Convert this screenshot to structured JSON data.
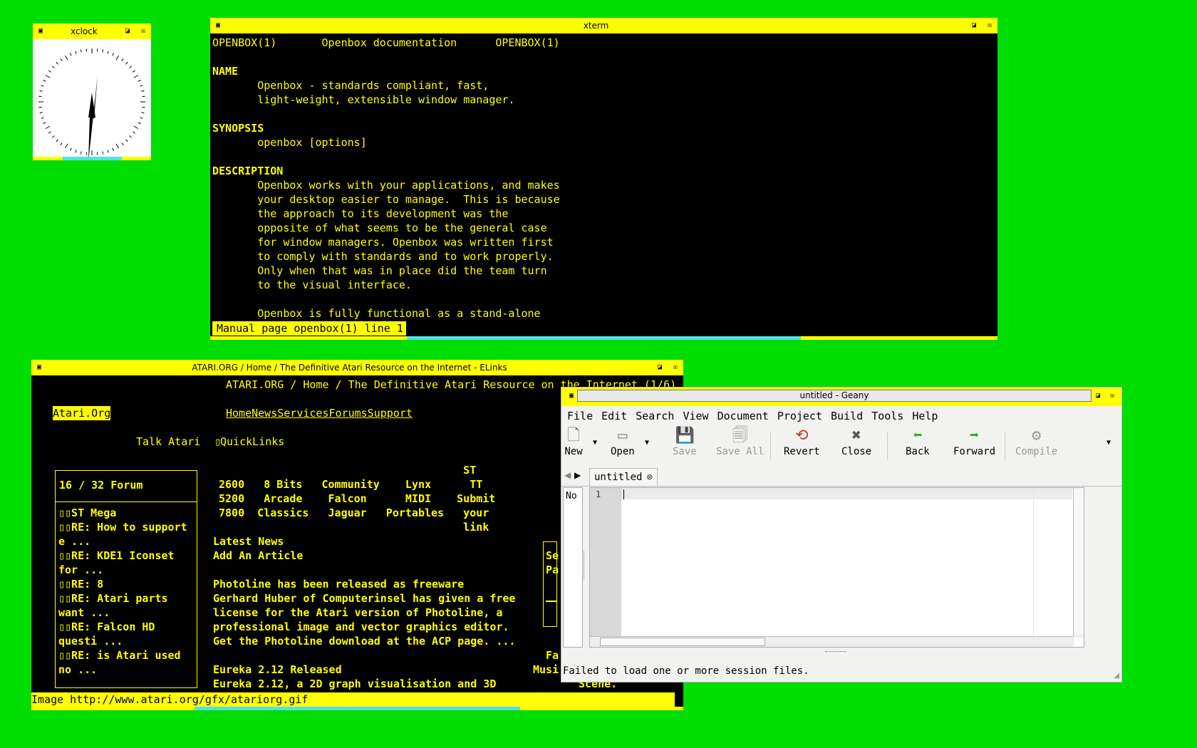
{
  "xclock": {
    "title": "xclock",
    "icons": {
      "menu": "window-menu-icon",
      "maximize": "maximize-icon",
      "close": "close-icon"
    }
  },
  "xterm": {
    "title": "xterm",
    "lines": [
      {
        "text": "OPENBOX(1)       Openbox documentation      OPENBOX(1)",
        "bold": false
      },
      {
        "text": "",
        "bold": false
      },
      {
        "text": "NAME",
        "bold": true
      },
      {
        "text": "       Openbox - standards compliant, fast,",
        "bold": false
      },
      {
        "text": "       light-weight, extensible window manager.",
        "bold": false
      },
      {
        "text": "",
        "bold": false
      },
      {
        "text": "SYNOPSIS",
        "bold": true
      },
      {
        "text": "       openbox [options]",
        "bold": false
      },
      {
        "text": "",
        "bold": false
      },
      {
        "text": "DESCRIPTION",
        "bold": true
      },
      {
        "text": "       Openbox works with your applications, and makes",
        "bold": false
      },
      {
        "text": "       your desktop easier to manage.  This is because",
        "bold": false
      },
      {
        "text": "       the approach to its development was the",
        "bold": false
      },
      {
        "text": "       opposite of what seems to be the general case",
        "bold": false
      },
      {
        "text": "       for window managers. Openbox was written first",
        "bold": false
      },
      {
        "text": "       to comply with standards and to work properly.",
        "bold": false
      },
      {
        "text": "       Only when that was in place did the team turn",
        "bold": false
      },
      {
        "text": "       to the visual interface.",
        "bold": false
      },
      {
        "text": "",
        "bold": false
      },
      {
        "text": "       Openbox is fully functional as a stand-alone",
        "bold": false
      }
    ],
    "status": "Manual page openbox(1) line 1"
  },
  "elinks": {
    "title": "ATARI.ORG / Home / The Definitive Atari Resource on the Internet - ELinks",
    "page_title": "ATARI.ORG / Home / The Definitive Atari Resource on the Internet (1/6)",
    "site_link": "Atari.Org",
    "nav": "HomeNewsServicesForumsSupport",
    "talk": "Talk Atari",
    "quicklinks": "QuickLinks",
    "forum_header": "16 / 32 Forum",
    "forum_lines": [
      "▯▯ST Mega",
      "▯▯RE: How to support",
      "e ...",
      "▯▯RE: KDE1 Iconset",
      "for ...",
      "▯▯RE: 8",
      "▯▯RE: Atari parts",
      "want ...",
      "▯▯RE: Falcon HD",
      "questi ...",
      "▯▯RE: is Atari used",
      "no ..."
    ],
    "categories": [
      "                                      ST",
      "2600   8 Bits   Community    Lynx      TT",
      "5200   Arcade    Falcon      MIDI    Submit",
      "7800  Classics   Jaguar   Portables   your",
      "                                      link"
    ],
    "news_lines": [
      "Latest News",
      "Add An Article",
      "",
      "Photoline has been released as freeware",
      "Gerhard Huber of Computerinsel has given a free",
      "license for the Atari version of Photoline, a",
      "professional image and vector graphics editor.",
      "Get the Photoline download at the ACP page. ...",
      "",
      "Eureka 2.12 Released",
      "Eureka 2.12, a 2D graph visualisation and 3D"
    ],
    "side_frag_1": "Se",
    "side_frag_2": "Pa",
    "side_frag_3": "Fa",
    "side_frag_4": "Musi",
    "side_frag_5": "Scene.",
    "status": "Image http://www.atari.org/gfx/atariorg.gif"
  },
  "geany": {
    "title": "untitled - Geany",
    "menu": [
      "File",
      "Edit",
      "Search",
      "View",
      "Document",
      "Project",
      "Build",
      "Tools",
      "Help"
    ],
    "toolbar": {
      "new": "New",
      "open": "Open",
      "save": "Save",
      "save_all": "Save All",
      "revert": "Revert",
      "close": "Close",
      "back": "Back",
      "forward": "Forward",
      "compile": "Compile"
    },
    "tab": "untitled",
    "sidebar_label": "No",
    "line_number": "1",
    "status": "Failed to load one or more session files."
  },
  "colors": {
    "desktop": "#00dd00",
    "titlebar": "#ffff00",
    "terminal_bg": "#000000",
    "terminal_fg": "#ffff00"
  }
}
